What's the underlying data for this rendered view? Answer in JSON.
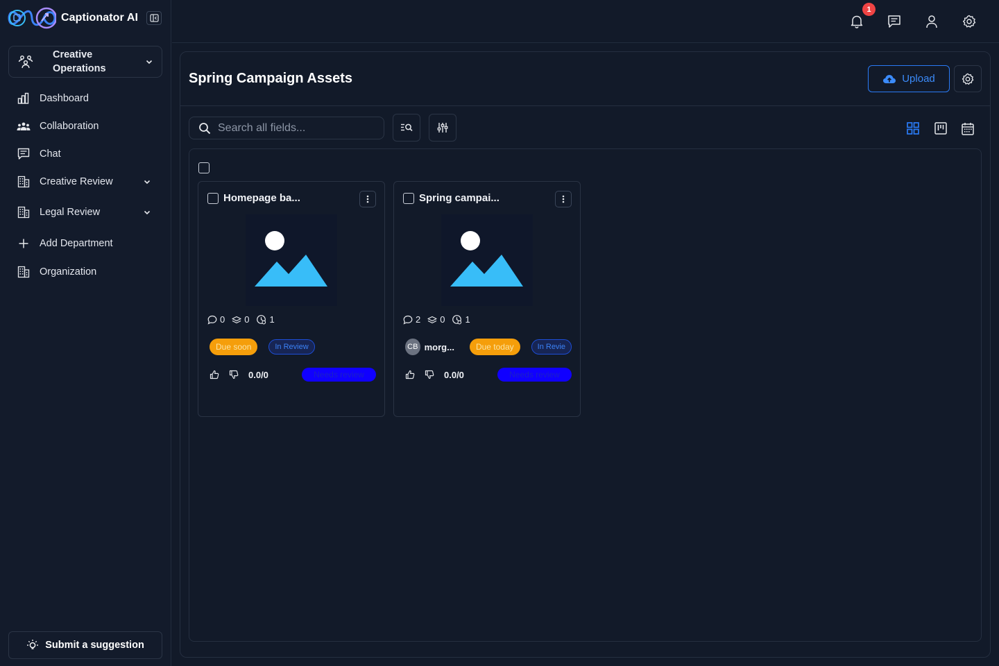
{
  "app": {
    "name": "Captionator AI"
  },
  "org": {
    "name": "Creative Operations"
  },
  "sidebar": {
    "items": [
      {
        "label": "Dashboard",
        "icon": "bar-chart-icon"
      },
      {
        "label": "Collaboration",
        "icon": "users-icon"
      },
      {
        "label": "Chat",
        "icon": "chat-icon"
      },
      {
        "label": "Creative Review",
        "icon": "building-icon",
        "expandable": true
      },
      {
        "label": "Legal Review",
        "icon": "building-icon",
        "expandable": true
      },
      {
        "label": "Add Department",
        "icon": "plus-icon"
      },
      {
        "label": "Organization",
        "icon": "building-icon"
      }
    ],
    "suggestion_label": "Submit a suggestion"
  },
  "topbar": {
    "notification_count": "1"
  },
  "page": {
    "title": "Spring Campaign Assets",
    "upload_label": "Upload",
    "search_placeholder": "Search all fields..."
  },
  "cards": [
    {
      "title": "Homepage ba...",
      "comments": "0",
      "layers": "0",
      "versions": "1",
      "owner_initials": "",
      "owner_name": "",
      "due": "Due soon",
      "status": "In Review",
      "score": "0.0/0",
      "review_state": "Needs review"
    },
    {
      "title": "Spring campai...",
      "comments": "2",
      "layers": "0",
      "versions": "1",
      "owner_initials": "CB",
      "owner_name": "morg...",
      "due": "Due today",
      "status": "In Revie",
      "score": "0.0/0",
      "review_state": "Needs review"
    }
  ],
  "colors": {
    "background": "#121a29",
    "accent": "#2a7bf6",
    "due_badge": "#f59e0b",
    "review_badge": "#1000ff",
    "notification_badge": "#ef4444",
    "thumbnail_fill": "#38bdf8"
  }
}
